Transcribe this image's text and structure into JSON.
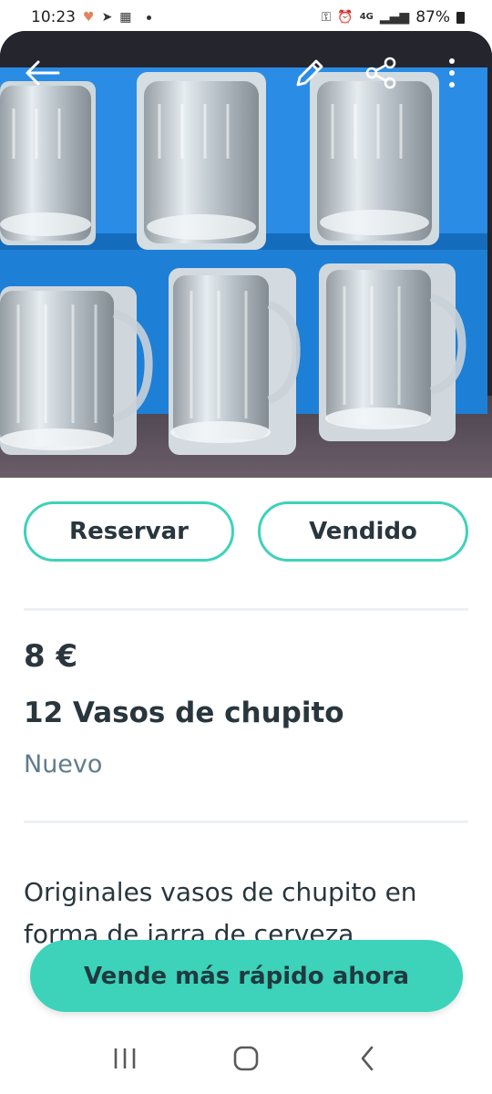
{
  "status_bar": {
    "time": "10:23",
    "network": "4G",
    "battery": "87%"
  },
  "listing": {
    "price": "8 €",
    "title": "12 Vasos de chupito",
    "condition": "Nuevo",
    "description": "Originales vasos de chupito en forma de jarra de cerveza"
  },
  "actions": {
    "reserve_label": "Reservar",
    "sold_label": "Vendido"
  },
  "promo": {
    "sell_faster_label": "Vende más rápido ahora"
  },
  "colors": {
    "accent": "#3dd2ba",
    "text": "#29363d",
    "muted": "#5f7d8c",
    "box_blue": "#1e88e5"
  },
  "icons": {
    "back": "back-arrow-icon",
    "edit": "pencil-icon",
    "share": "share-icon",
    "more": "more-vertical-icon"
  }
}
